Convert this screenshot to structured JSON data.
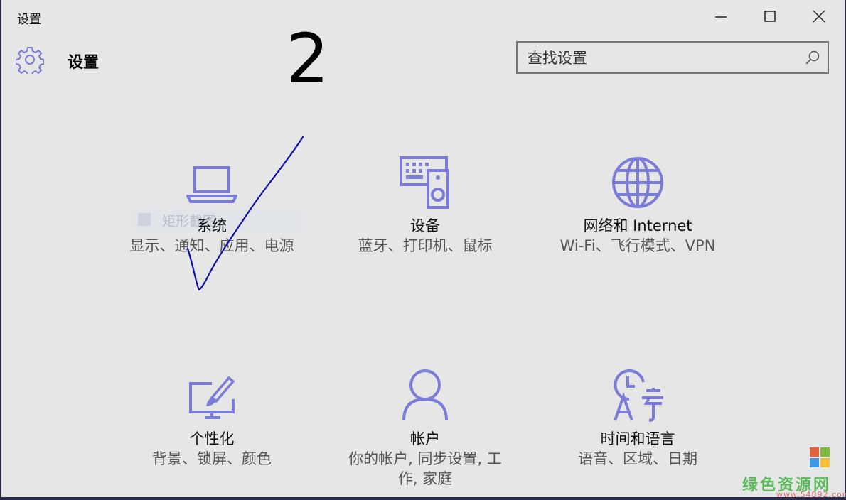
{
  "window": {
    "title": "设置"
  },
  "header": {
    "title": "设置",
    "annotation_number": "2"
  },
  "search": {
    "placeholder": "查找设置"
  },
  "tiles": [
    {
      "title": "系统",
      "subtitle": "显示、通知、应用、电源",
      "icon": "laptop-icon"
    },
    {
      "title": "设备",
      "subtitle": "蓝牙、打印机、鼠标",
      "icon": "devices-icon"
    },
    {
      "title": "网络和 Internet",
      "subtitle": "Wi-Fi、飞行模式、VPN",
      "icon": "globe-icon"
    },
    {
      "title": "个性化",
      "subtitle": "背景、锁屏、颜色",
      "icon": "personalization-icon"
    },
    {
      "title": "帐户",
      "subtitle": "你的帐户, 同步设置, 工作, 家庭",
      "icon": "person-icon"
    },
    {
      "title": "时间和语言",
      "subtitle": "语音、区域、日期",
      "icon": "time-language-icon"
    }
  ],
  "ghost_label": "矩形截图",
  "watermark": {
    "text": "绿色资源网",
    "url": "www.54092.com"
  },
  "colors": {
    "accent": "#7b7bd8",
    "background": "#e6e6e6",
    "annotation_stroke": "#1010b0"
  }
}
